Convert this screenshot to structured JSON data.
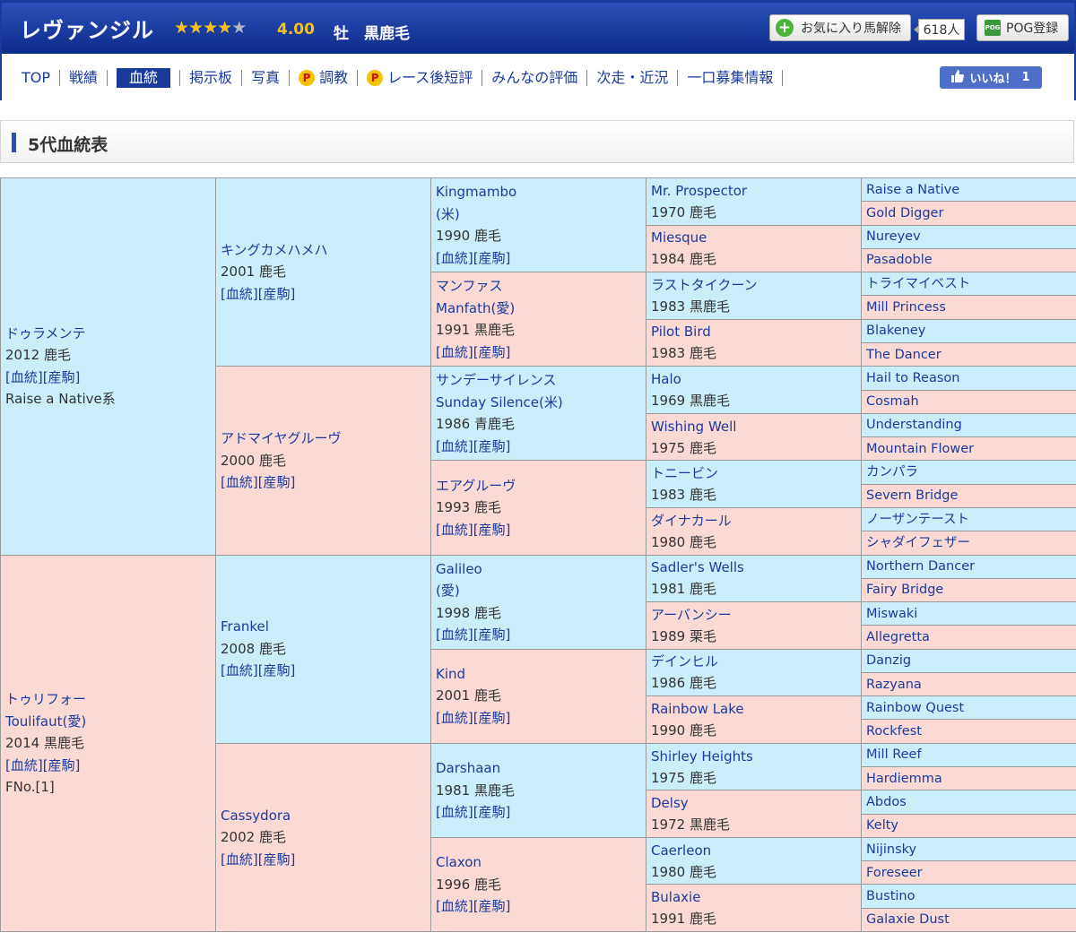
{
  "header": {
    "horse_name": "レヴァンジル",
    "stars": 4,
    "rating": "4.00",
    "info": "牡　黒鹿毛",
    "favorite_label": "お気に入り馬解除",
    "favorite_count": "618人",
    "pog_label": "POG登録",
    "pog_icon_text": "POG"
  },
  "nav": {
    "items": [
      {
        "label": "TOP",
        "active": false,
        "premium": false
      },
      {
        "label": "戦績",
        "active": false,
        "premium": false
      },
      {
        "label": "血統",
        "active": true,
        "premium": false
      },
      {
        "label": "掲示板",
        "active": false,
        "premium": false
      },
      {
        "label": "写真",
        "active": false,
        "premium": false
      },
      {
        "label": "調教",
        "active": false,
        "premium": true
      },
      {
        "label": "レース後短評",
        "active": false,
        "premium": true
      },
      {
        "label": "みんなの評価",
        "active": false,
        "premium": false
      },
      {
        "label": "次走・近況",
        "active": false,
        "premium": false
      },
      {
        "label": "一口募集情報",
        "active": false,
        "premium": false
      }
    ],
    "premium_icon": "P",
    "like_label": "いいね！",
    "like_count": "1"
  },
  "section": {
    "title": "5代血統表"
  },
  "pedigree": {
    "colors": {
      "sire": "#cbeefb",
      "dam": "#fbd9d5",
      "link": "#1a3b9c"
    },
    "g1": [
      {
        "lines": [
          {
            "t": "ドゥラメンテ",
            "link": true
          },
          {
            "t": "2012 鹿毛",
            "link": false
          },
          {
            "t": "[血統][産駒]",
            "link": true
          },
          {
            "t": "Raise a Native系",
            "link": false
          }
        ]
      },
      {
        "lines": [
          {
            "t": "トゥリフォー",
            "link": true
          },
          {
            "t": "Toulifaut(愛)",
            "link": true
          },
          {
            "t": "2014 黒鹿毛",
            "link": false
          },
          {
            "t": "[血統][産駒]",
            "link": true
          },
          {
            "t": "FNo.[1]",
            "link": false
          }
        ]
      }
    ],
    "g2": [
      {
        "lines": [
          {
            "t": "キングカメハメハ",
            "link": true
          },
          {
            "t": "2001 鹿毛",
            "link": false
          },
          {
            "t": "[血統][産駒]",
            "link": true
          }
        ]
      },
      {
        "lines": [
          {
            "t": "アドマイヤグルーヴ",
            "link": true
          },
          {
            "t": "2000 鹿毛",
            "link": false
          },
          {
            "t": "[血統][産駒]",
            "link": true
          }
        ]
      },
      {
        "lines": [
          {
            "t": "Frankel",
            "link": true
          },
          {
            "t": "2008 鹿毛",
            "link": false
          },
          {
            "t": "[血統][産駒]",
            "link": true
          }
        ]
      },
      {
        "lines": [
          {
            "t": "Cassydora",
            "link": true
          },
          {
            "t": "2002 鹿毛",
            "link": false
          },
          {
            "t": "[血統][産駒]",
            "link": true
          }
        ]
      }
    ],
    "g3": [
      {
        "lines": [
          {
            "t": "Kingmambo",
            "link": true
          },
          {
            "t": "(米)",
            "link": true
          },
          {
            "t": "1990 鹿毛",
            "link": false
          },
          {
            "t": "[血統][産駒]",
            "link": true
          }
        ]
      },
      {
        "lines": [
          {
            "t": "マンファス",
            "link": true
          },
          {
            "t": "Manfath(愛)",
            "link": true
          },
          {
            "t": "1991 黒鹿毛",
            "link": false
          },
          {
            "t": "[血統][産駒]",
            "link": true
          }
        ]
      },
      {
        "lines": [
          {
            "t": "サンデーサイレンス",
            "link": true
          },
          {
            "t": "Sunday Silence(米)",
            "link": true
          },
          {
            "t": "1986 青鹿毛",
            "link": false
          },
          {
            "t": "[血統][産駒]",
            "link": true
          }
        ]
      },
      {
        "lines": [
          {
            "t": "エアグルーヴ",
            "link": true
          },
          {
            "t": "1993 鹿毛",
            "link": false
          },
          {
            "t": "[血統][産駒]",
            "link": true
          }
        ]
      },
      {
        "lines": [
          {
            "t": "Galileo",
            "link": true
          },
          {
            "t": "(愛)",
            "link": true
          },
          {
            "t": "1998 鹿毛",
            "link": false
          },
          {
            "t": "[血統][産駒]",
            "link": true
          }
        ]
      },
      {
        "lines": [
          {
            "t": "Kind",
            "link": true
          },
          {
            "t": "2001 鹿毛",
            "link": false
          },
          {
            "t": "[血統][産駒]",
            "link": true
          }
        ]
      },
      {
        "lines": [
          {
            "t": "Darshaan",
            "link": true
          },
          {
            "t": "1981 黒鹿毛",
            "link": false
          },
          {
            "t": "[血統][産駒]",
            "link": true
          }
        ]
      },
      {
        "lines": [
          {
            "t": "Claxon",
            "link": true
          },
          {
            "t": "1996 鹿毛",
            "link": false
          },
          {
            "t": "[血統][産駒]",
            "link": true
          }
        ]
      }
    ],
    "g4": [
      {
        "lines": [
          {
            "t": "Mr. Prospector",
            "link": true
          },
          {
            "t": "1970 鹿毛",
            "link": false
          }
        ]
      },
      {
        "lines": [
          {
            "t": "Miesque",
            "link": true
          },
          {
            "t": "1984 鹿毛",
            "link": false
          }
        ]
      },
      {
        "lines": [
          {
            "t": "ラストタイクーン",
            "link": true
          },
          {
            "t": "1983 黒鹿毛",
            "link": false
          }
        ]
      },
      {
        "lines": [
          {
            "t": "Pilot Bird",
            "link": true
          },
          {
            "t": "1983 鹿毛",
            "link": false
          }
        ]
      },
      {
        "lines": [
          {
            "t": "Halo",
            "link": true
          },
          {
            "t": "1969 黒鹿毛",
            "link": false
          }
        ]
      },
      {
        "lines": [
          {
            "t": "Wishing Well",
            "link": true
          },
          {
            "t": "1975 鹿毛",
            "link": false
          }
        ]
      },
      {
        "lines": [
          {
            "t": "トニービン",
            "link": true
          },
          {
            "t": "1983 鹿毛",
            "link": false
          }
        ]
      },
      {
        "lines": [
          {
            "t": "ダイナカール",
            "link": true
          },
          {
            "t": "1980 鹿毛",
            "link": false
          }
        ]
      },
      {
        "lines": [
          {
            "t": "Sadler's Wells",
            "link": true
          },
          {
            "t": "1981 鹿毛",
            "link": false
          }
        ]
      },
      {
        "lines": [
          {
            "t": "アーバンシー",
            "link": true
          },
          {
            "t": "1989 栗毛",
            "link": false
          }
        ]
      },
      {
        "lines": [
          {
            "t": "デインヒル",
            "link": true
          },
          {
            "t": "1986 鹿毛",
            "link": false
          }
        ]
      },
      {
        "lines": [
          {
            "t": "Rainbow Lake",
            "link": true
          },
          {
            "t": "1990 鹿毛",
            "link": false
          }
        ]
      },
      {
        "lines": [
          {
            "t": "Shirley Heights",
            "link": true
          },
          {
            "t": "1975 鹿毛",
            "link": false
          }
        ]
      },
      {
        "lines": [
          {
            "t": "Delsy",
            "link": true
          },
          {
            "t": "1972 黒鹿毛",
            "link": false
          }
        ]
      },
      {
        "lines": [
          {
            "t": "Caerleon",
            "link": true
          },
          {
            "t": "1980 鹿毛",
            "link": false
          }
        ]
      },
      {
        "lines": [
          {
            "t": "Bulaxie",
            "link": true
          },
          {
            "t": "1991 鹿毛",
            "link": false
          }
        ]
      }
    ],
    "g5": [
      "Raise a Native",
      "Gold Digger",
      "Nureyev",
      "Pasadoble",
      "トライマイベスト",
      "Mill Princess",
      "Blakeney",
      "The Dancer",
      "Hail to Reason",
      "Cosmah",
      "Understanding",
      "Mountain Flower",
      "カンパラ",
      "Severn Bridge",
      "ノーザンテースト",
      "シャダイフェザー",
      "Northern Dancer",
      "Fairy Bridge",
      "Miswaki",
      "Allegretta",
      "Danzig",
      "Razyana",
      "Rainbow Quest",
      "Rockfest",
      "Mill Reef",
      "Hardiemma",
      "Abdos",
      "Kelty",
      "Nijinsky",
      "Foreseer",
      "Bustino",
      "Galaxie Dust"
    ]
  }
}
